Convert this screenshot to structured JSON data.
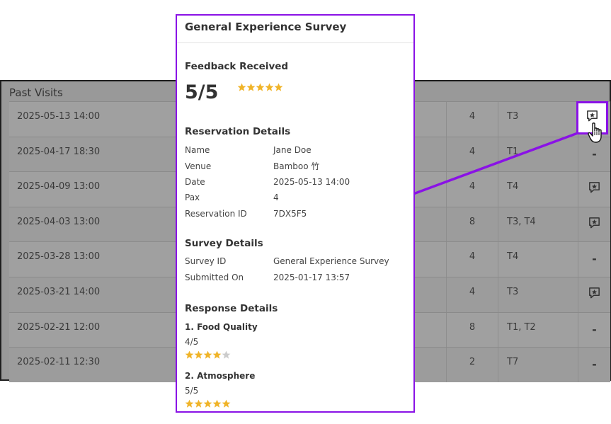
{
  "past_visits": {
    "title": "Past Visits",
    "rows": [
      {
        "date": "2025-05-13 14:00",
        "pax": "4",
        "tables": "T3",
        "action": "icon"
      },
      {
        "date": "2025-04-17 18:30",
        "pax": "4",
        "tables": "T1",
        "action": "-"
      },
      {
        "date": "2025-04-09 13:00",
        "pax": "4",
        "tables": "T4",
        "action": "icon"
      },
      {
        "date": "2025-04-03 13:00",
        "pax": "8",
        "tables": "T3, T4",
        "action": "icon"
      },
      {
        "date": "2025-03-28 13:00",
        "pax": "4",
        "tables": "T4",
        "action": "-"
      },
      {
        "date": "2025-03-21 14:00",
        "pax": "4",
        "tables": "T3",
        "action": "icon"
      },
      {
        "date": "2025-02-21 12:00",
        "pax": "8",
        "tables": "T1, T2",
        "action": "-"
      },
      {
        "date": "2025-02-11 12:30",
        "pax": "2",
        "tables": "T7",
        "action": "-"
      }
    ]
  },
  "survey": {
    "title": "General Experience Survey",
    "feedback": {
      "label": "Feedback Received",
      "score": "5/5",
      "rating": 5,
      "max": 5
    },
    "reservation": {
      "label": "Reservation Details",
      "fields": [
        {
          "k": "Name",
          "v": "Jane Doe"
        },
        {
          "k": "Venue",
          "v": "Bamboo 竹"
        },
        {
          "k": "Date",
          "v": "2025-05-13 14:00"
        },
        {
          "k": "Pax",
          "v": "4"
        },
        {
          "k": "Reservation ID",
          "v": "7DX5F5"
        }
      ]
    },
    "survey_details": {
      "label": "Survey Details",
      "fields": [
        {
          "k": "Survey ID",
          "v": "General Experience Survey"
        },
        {
          "k": "Submitted On",
          "v": "2025-01-17 13:57"
        }
      ]
    },
    "responses": {
      "label": "Response Details",
      "items": [
        {
          "question": "1. Food Quality",
          "answer": "4/5",
          "rating": 4,
          "max": 5
        },
        {
          "question": "2. Atmosphere",
          "answer": "5/5",
          "rating": 5,
          "max": 5
        }
      ]
    }
  },
  "colors": {
    "accent": "#8a12e6",
    "star": "#f0b429",
    "star_empty": "#cccccc",
    "overlay": "#999999"
  },
  "icons": {
    "feedback": "chat-star-icon",
    "cursor": "hand-pointer-icon"
  }
}
